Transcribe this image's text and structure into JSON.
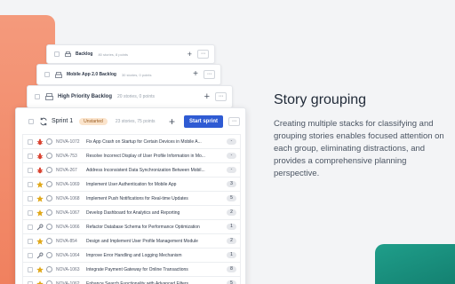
{
  "backlog_cards": [
    {
      "title": "Backlog",
      "meta": "80 stories, 8 points"
    },
    {
      "title": "Mobile App 2.0 Backlog",
      "meta": "30 stories, 0 points"
    },
    {
      "title": "High Priority Backlog",
      "meta": "20 stories, 0 points"
    }
  ],
  "sprint": {
    "title": "Sprint 1",
    "status": "Unstarted",
    "meta": "23 stories, 75 points",
    "start_label": "Start sprint",
    "more_label": "···",
    "add_label": "+"
  },
  "issues": [
    {
      "type": "bug",
      "key": "NOVA-1072",
      "summary": "Fix App Crash on Startup for Certain Devices in Mobile A...",
      "points": "-"
    },
    {
      "type": "bug",
      "key": "NOVA-753",
      "summary": "Resolve Incorrect Display of User Profile Information in Mo...",
      "points": "-"
    },
    {
      "type": "bug",
      "key": "NOVA-267",
      "summary": "Address Inconsistent Data Synchronization Between Mobil...",
      "points": "-"
    },
    {
      "type": "story",
      "key": "NOVA-1069",
      "summary": "Implement User Authentication for Mobile App",
      "points": "3"
    },
    {
      "type": "story",
      "key": "NOVA-1068",
      "summary": "Implement Push Notifications for Real-time Updates",
      "points": "5"
    },
    {
      "type": "story",
      "key": "NOVA-1067",
      "summary": "Develop Dashboard for Analytics and Reporting",
      "points": "2"
    },
    {
      "type": "task",
      "key": "NOVA-1066",
      "summary": "Refactor Database Schema for Performance Optimization",
      "points": "1"
    },
    {
      "type": "story",
      "key": "NOVA-854",
      "summary": "Design and Implement User Profile Management Module",
      "points": "2"
    },
    {
      "type": "task",
      "key": "NOVA-1064",
      "summary": "Improve Error Handling and Logging Mechanism",
      "points": "1"
    },
    {
      "type": "story",
      "key": "NOVA-1063",
      "summary": "Integrate Payment Gateway for Online Transactions",
      "points": "8"
    },
    {
      "type": "story",
      "key": "NOVA-1062",
      "summary": "Enhance Search Functionality with Advanced Filters",
      "points": "5"
    }
  ],
  "promo": {
    "heading": "Story grouping",
    "description": "Creating multiple stacks for classifying and grouping stories enables focused attention on each group, eliminating distractions, and provides a comprehensive planning perspective."
  },
  "colors": {
    "accent": "#2f5bd3",
    "bug": "#d9412f",
    "story": "#e0a81a",
    "task": "#6b7280",
    "deco_orange": "#f0805e",
    "deco_teal": "#117a6b"
  }
}
